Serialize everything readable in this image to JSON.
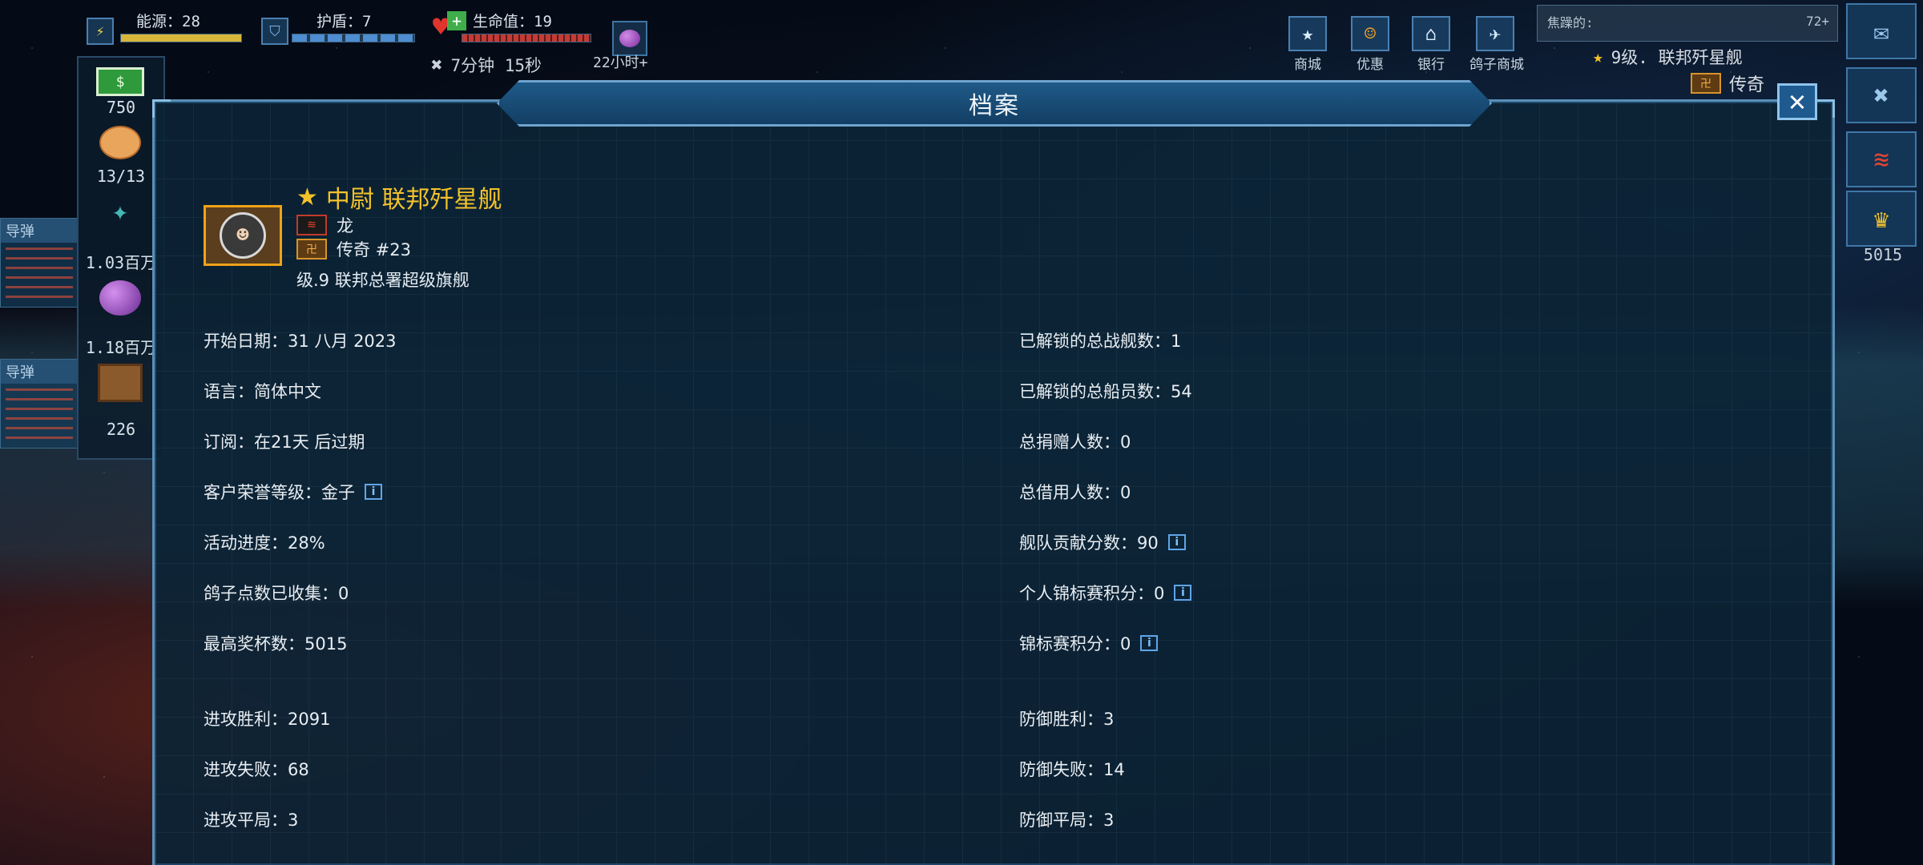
{
  "hud": {
    "energy": "能源：28",
    "shield": "护盾：7",
    "health": "生命值：19",
    "timer": "7分钟 15秒",
    "orb_timer": "22小时+"
  },
  "resources": {
    "cash": "750",
    "crew": "13/13",
    "crystal": "1.03百万",
    "orb": "1.18百万",
    "crate": "226",
    "panel_label_1": "导弹",
    "panel_label_2": "导弹"
  },
  "topbar": {
    "search_label": "焦躁的:",
    "search_badge": "72+",
    "shops": [
      {
        "label": "商城",
        "icon": "star-icon"
      },
      {
        "label": "优惠",
        "icon": "smile-icon"
      },
      {
        "label": "银行",
        "icon": "bank-icon"
      },
      {
        "label": "鸽子商城",
        "icon": "bird-icon"
      }
    ],
    "rank_text": "9级. 联邦歼星舰",
    "tier_text": "传奇"
  },
  "right": {
    "trophies": "5015"
  },
  "dialog": {
    "title": "档案",
    "rank_title": "中尉 联邦歼星舰",
    "name": "龙",
    "tier": "传奇 #23",
    "ship": "级.9 联邦总署超级旗舰",
    "left_stats": [
      "开始日期：31 八月 2023",
      "语言：简体中文",
      "订阅：在21天 后过期",
      "客户荣誉等级：金子",
      "活动进度：28%",
      "鸽子点数已收集：0",
      "最高奖杯数：5015"
    ],
    "right_stats": [
      "已解锁的总战舰数：1",
      "已解锁的总船员数：54",
      "总捐赠人数：0",
      "总借用人数：0",
      "舰队贡献分数：90",
      "个人锦标赛积分：0",
      "锦标赛积分：0"
    ],
    "battle_left": [
      "进攻胜利：2091",
      "进攻失败：68",
      "进攻平局：3"
    ],
    "battle_right": [
      "防御胜利：3",
      "防御失败：14",
      "防御平局：3"
    ]
  },
  "colors": {
    "accent_gold": "#f3c22a",
    "panel_bg": "#0c2436",
    "border": "#5a8fb8",
    "info_blue": "#5fa6ea"
  }
}
